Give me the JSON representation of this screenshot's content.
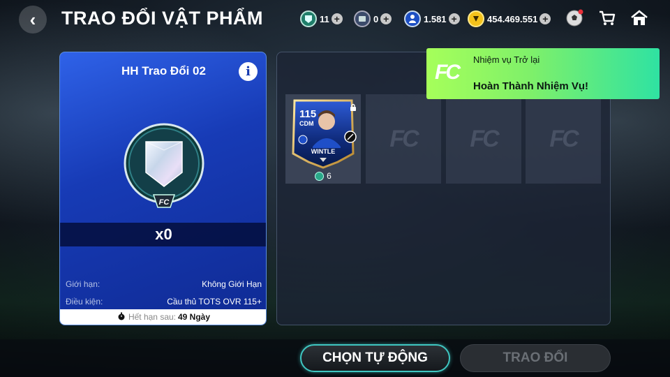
{
  "header": {
    "back_icon": "‹",
    "title": "TRAO ĐỔI VẬT PHẨM",
    "currencies": [
      {
        "name": "exchange-gem",
        "value": "11",
        "color": "#2aa889"
      },
      {
        "name": "ticket",
        "value": "0",
        "color": "#5c6fa0"
      },
      {
        "name": "player-token",
        "value": "1.581",
        "color": "#2a63d6"
      },
      {
        "name": "bp-coin",
        "value": "454.469.551",
        "color": "#f4c21b"
      }
    ],
    "icons": [
      "football-icon",
      "cart-icon",
      "home-icon"
    ]
  },
  "exchange_panel": {
    "title": "HH Trao Đổi 02",
    "info_icon": "i",
    "count": "x0",
    "limit_label": "Giới hạn:",
    "limit_value": "Không Giới Hạn",
    "condition_label": "Điều kiện:",
    "condition_value": "Cầu thủ TOTS OVR 115+",
    "expiry_label": "Hết hạn sau:",
    "expiry_value": "49 Ngày"
  },
  "selected_cards": [
    {
      "rating": "115",
      "position": "CDM",
      "name": "WINTLE",
      "value": "6"
    }
  ],
  "empty_slot_logo": "FC",
  "notification": {
    "logo": "FC",
    "title": "Nhiệm vụ Trở lại",
    "message": "Hoàn Thành Nhiệm Vụ!"
  },
  "buttons": {
    "auto_select": "CHỌN TỰ ĐỘNG",
    "exchange": "TRAO ĐỔI"
  }
}
